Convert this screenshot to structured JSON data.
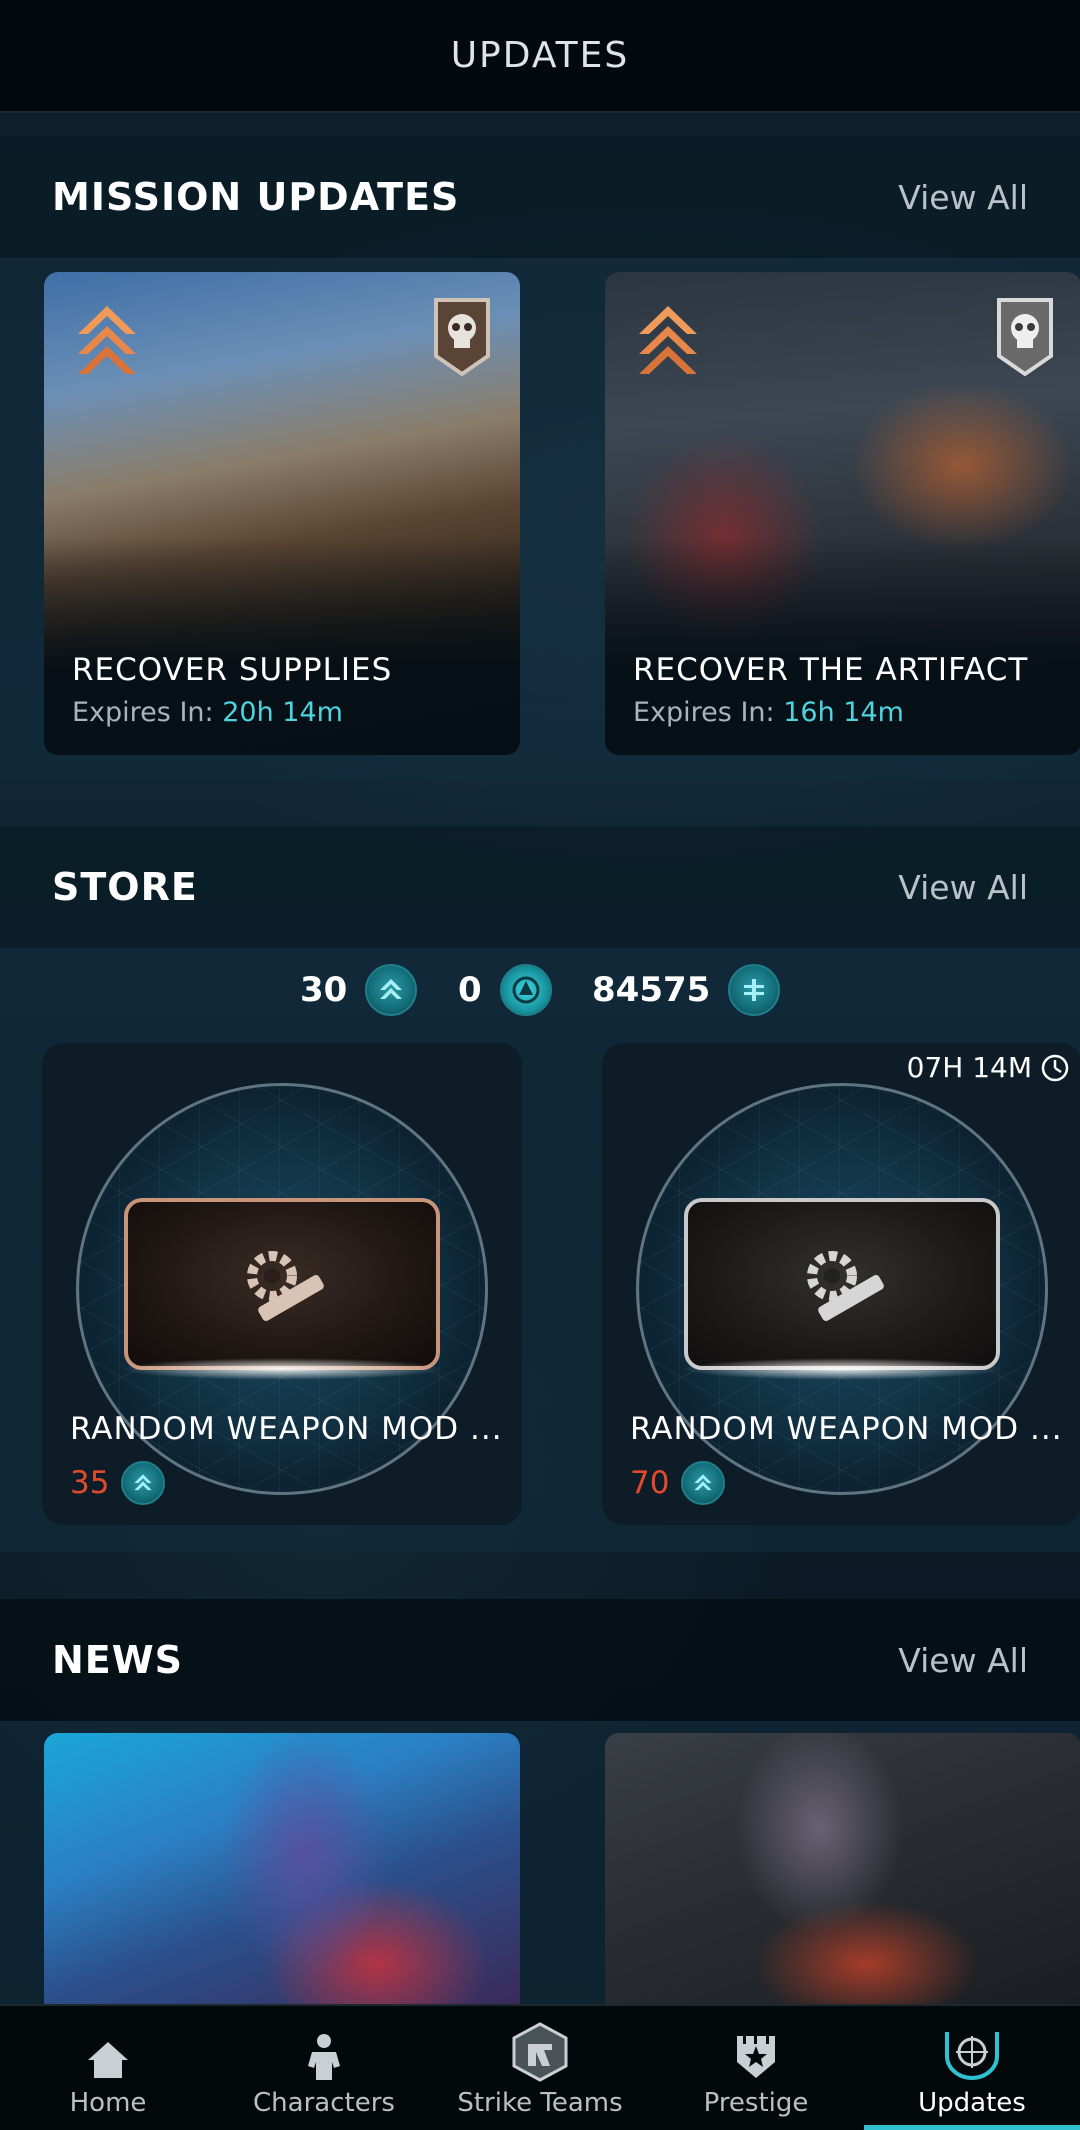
{
  "header": {
    "title": "UPDATES"
  },
  "mission_updates": {
    "title": "MISSION UPDATES",
    "view_all": "View All",
    "cards": [
      {
        "title": "RECOVER SUPPLIES",
        "expires_label": "Expires In:",
        "expires_value": "20h 14m"
      },
      {
        "title": "RECOVER THE ARTIFACT",
        "expires_label": "Expires In:",
        "expires_value": "16h 14m"
      }
    ]
  },
  "store": {
    "title": "STORE",
    "view_all": "View All",
    "currencies": [
      {
        "amount": "30",
        "icon": "rank-chevron-icon"
      },
      {
        "amount": "0",
        "icon": "premium-currency-icon"
      },
      {
        "amount": "84575",
        "icon": "credits-icon"
      }
    ],
    "items": [
      {
        "title": "RANDOM WEAPON MOD ...",
        "price": "35",
        "timer": ""
      },
      {
        "title": "RANDOM WEAPON MOD ...",
        "price": "70",
        "timer": "07H 14M"
      }
    ]
  },
  "news": {
    "title": "NEWS",
    "view_all": "View All"
  },
  "nav": {
    "items": [
      {
        "label": "Home",
        "icon": "home-icon"
      },
      {
        "label": "Characters",
        "icon": "characters-icon"
      },
      {
        "label": "Strike Teams",
        "icon": "strike-teams-icon"
      },
      {
        "label": "Prestige",
        "icon": "prestige-icon"
      },
      {
        "label": "Updates",
        "icon": "updates-icon",
        "active": true
      }
    ]
  },
  "colors": {
    "accent": "#2fc1cf",
    "expires": "#4fd3de",
    "price": "#e24a2c"
  }
}
